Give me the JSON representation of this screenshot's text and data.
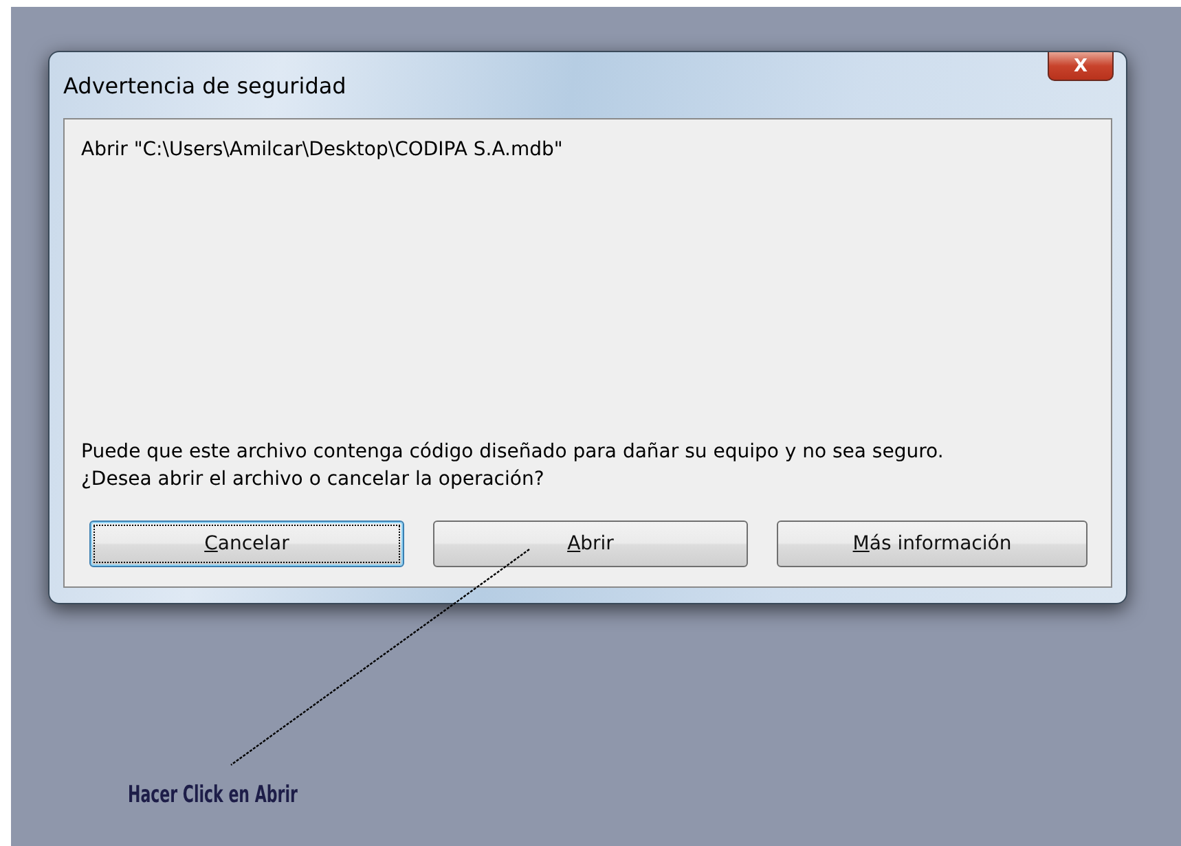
{
  "window": {
    "title": "Advertencia de seguridad",
    "close_button": "X"
  },
  "message": {
    "file_line": "Abrir \"C:\\Users\\Amilcar\\Desktop\\CODIPA S.A.mdb\"",
    "warning": "Puede que este archivo contenga código diseñado para dañar su equipo y no sea seguro.",
    "question": "¿Desea abrir el archivo o cancelar la operación?"
  },
  "buttons": [
    {
      "label": "Cancelar",
      "focused": true
    },
    {
      "label": "Abrir",
      "focused": false
    },
    {
      "label": "Más información",
      "focused": false
    }
  ],
  "annotation": {
    "text": "Hacer Click en Abrir"
  }
}
